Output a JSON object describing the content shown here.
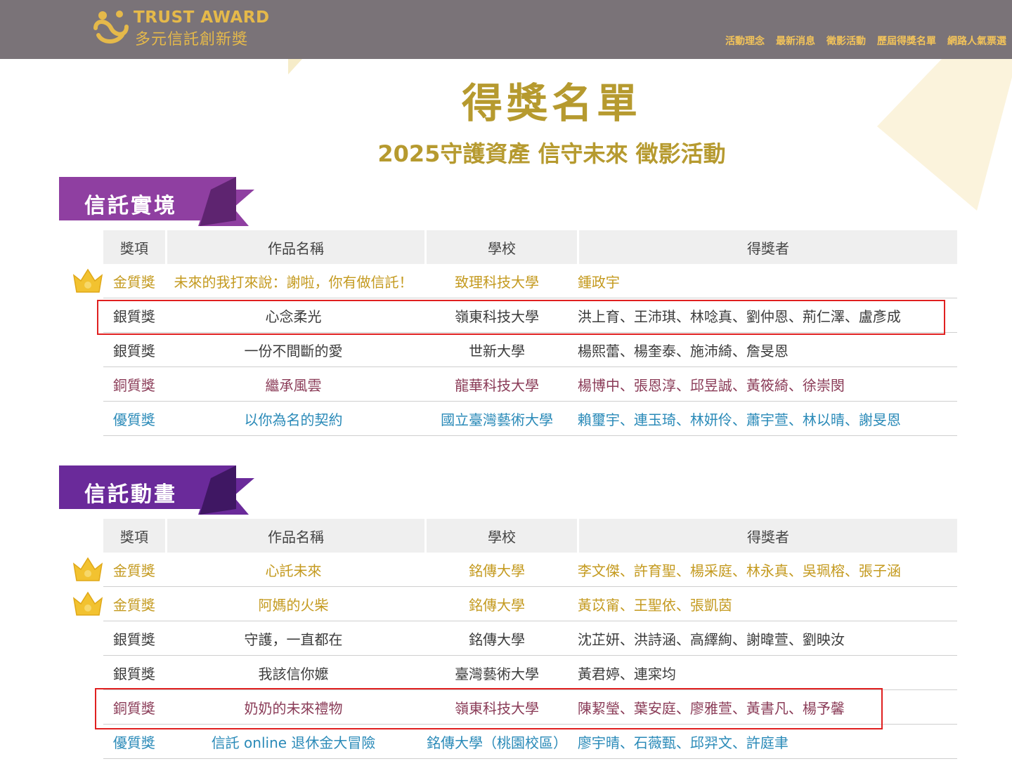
{
  "header": {
    "logo_en": "TRUST AWARD",
    "logo_zh": "多元信託創新獎",
    "nav": [
      "活動理念",
      "最新消息",
      "徵影活動",
      "歷屆得獎名單",
      "網路人氣票選"
    ]
  },
  "page": {
    "title": "得獎名單",
    "subtitle": "2025守護資產 信守未來 徵影活動"
  },
  "colors": {
    "brand_gold": "#b69a2f",
    "header_bg": "#7a7378",
    "nav_text": "#f2c35a",
    "banner_purple_1": "#8f3fa1",
    "banner_purple_2": "#6a2a9a",
    "gold_award": "#c49a1f",
    "bronze_award": "#8a3b57",
    "merit_award": "#2a8ab8",
    "highlight_box": "#e02020"
  },
  "sections": [
    {
      "label": "信託實境",
      "headers": [
        "獎項",
        "作品名稱",
        "學校",
        "得獎者"
      ],
      "rows": [
        {
          "award": "金質獎",
          "work": "未來的我打來說：謝啦，你有做信託！",
          "school": "致理科技大學",
          "winners": "鍾政宇",
          "tier": "gold",
          "crown": true,
          "highlighted": false
        },
        {
          "award": "銀質獎",
          "work": "心念柔光",
          "school": "嶺東科技大學",
          "winners": "洪上育、王沛琪、林唸真、劉仲恩、荊仁澤、盧彥成",
          "tier": "silver",
          "crown": false,
          "highlighted": true
        },
        {
          "award": "銀質獎",
          "work": "一份不間斷的愛",
          "school": "世新大學",
          "winners": "楊熙蕾、楊奎泰、施沛綺、詹旻恩",
          "tier": "silver",
          "crown": false,
          "highlighted": false
        },
        {
          "award": "銅質獎",
          "work": "繼承風雲",
          "school": "龍華科技大學",
          "winners": "楊博中、張恩淳、邱昱誠、黃筱綺、徐崇閔",
          "tier": "bronze",
          "crown": false,
          "highlighted": false
        },
        {
          "award": "優質獎",
          "work": "以你為名的契約",
          "school": "國立臺灣藝術大學",
          "winners": "賴璽宇、連玉琦、林妍伶、蕭宇萱、林以晴、謝旻恩",
          "tier": "merit",
          "crown": false,
          "highlighted": false
        }
      ]
    },
    {
      "label": "信託動畫",
      "headers": [
        "獎項",
        "作品名稱",
        "學校",
        "得獎者"
      ],
      "rows": [
        {
          "award": "金質獎",
          "work": "心託未來",
          "school": "銘傳大學",
          "winners": "李文傑、許育聖、楊采庭、林永真、吳珮榕、張子涵",
          "tier": "gold",
          "crown": true,
          "highlighted": false
        },
        {
          "award": "金質獎",
          "work": "阿媽的火柴",
          "school": "銘傳大學",
          "winners": "黃苡甯、王聖依、張凱茵",
          "tier": "gold",
          "crown": true,
          "highlighted": false
        },
        {
          "award": "銀質獎",
          "work": "守護，一直都在",
          "school": "銘傳大學",
          "winners": "沈芷妍、洪詩涵、高繹絢、謝暐萱、劉映汝",
          "tier": "silver",
          "crown": false,
          "highlighted": false
        },
        {
          "award": "銀質獎",
          "work": "我該信你嬤",
          "school": "臺灣藝術大學",
          "winners": "黃君婷、連寀均",
          "tier": "silver",
          "crown": false,
          "highlighted": false
        },
        {
          "award": "銅質獎",
          "work": "奶奶的未來禮物",
          "school": "嶺東科技大學",
          "winners": "陳絜瑩、葉安庭、廖雅萱、黃書凡、楊予馨",
          "tier": "bronze",
          "crown": false,
          "highlighted": true
        },
        {
          "award": "優質獎",
          "work": "信託 online 退休金大冒險",
          "school": "銘傳大學（桃園校區）",
          "winners": "廖宇晴、石薇甄、邱羿文、許庭聿",
          "tier": "merit",
          "crown": false,
          "highlighted": false
        }
      ]
    }
  ]
}
